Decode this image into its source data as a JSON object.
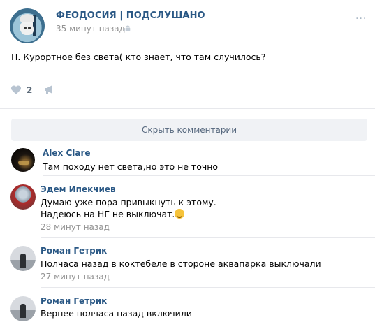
{
  "post": {
    "group_name": "ФЕОДОСИЯ | ПОДСЛУШАНО",
    "time": "35 минут назад",
    "text": "П. Курортное без света( кто знает, что там случилось?",
    "likes": "2",
    "more": "···"
  },
  "hide_comments_label": "Скрыть комментарии",
  "comments": [
    {
      "author": "Alex Clare",
      "text": "Там походу нет света,но это не точно"
    },
    {
      "author": "Эдем Ипекчиев",
      "text_line1": "Думаю уже пора привыкнуть к этому.",
      "text_line2": "Надеюсь на НГ не выключат.",
      "time": "28 минут назад"
    },
    {
      "author": "Роман Гетрик",
      "text": "Полчаса назад в коктебеле в стороне аквапарка выключали",
      "time": "27 минут назад"
    },
    {
      "author": "Роман Гетрик",
      "text": "Вернее полчаса назад включили"
    }
  ],
  "colors": {
    "link": "#2a5885",
    "meta": "#939393",
    "button_bg": "#f0f2f5"
  }
}
